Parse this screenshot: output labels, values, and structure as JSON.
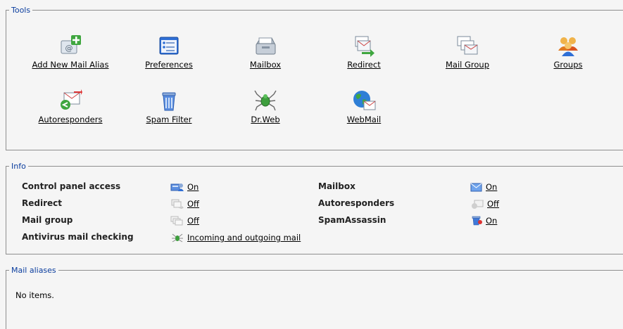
{
  "sections": {
    "tools": "Tools",
    "info": "Info",
    "mail_aliases": "Mail aliases"
  },
  "tools": [
    {
      "label": "Add New Mail Alias",
      "icon": "add-mail-alias-icon"
    },
    {
      "label": "Preferences",
      "icon": "preferences-icon"
    },
    {
      "label": "Mailbox",
      "icon": "mailbox-icon"
    },
    {
      "label": "Redirect",
      "icon": "redirect-icon"
    },
    {
      "label": "Mail Group",
      "icon": "mail-group-icon"
    },
    {
      "label": "Groups",
      "icon": "groups-icon"
    },
    {
      "label": "Autoresponders",
      "icon": "autoresponders-icon"
    },
    {
      "label": "Spam Filter",
      "icon": "spam-filter-icon"
    },
    {
      "label": "Dr.Web",
      "icon": "drweb-icon"
    },
    {
      "label": "WebMail",
      "icon": "webmail-icon"
    }
  ],
  "info": {
    "control_panel_access": {
      "label": "Control panel access",
      "value": "On"
    },
    "mailbox": {
      "label": "Mailbox",
      "value": "On"
    },
    "redirect": {
      "label": "Redirect",
      "value": "Off"
    },
    "autoresponders": {
      "label": "Autoresponders",
      "value": "Off"
    },
    "mail_group": {
      "label": "Mail group",
      "value": "Off"
    },
    "spamassassin": {
      "label": "SpamAssassin",
      "value": "On"
    },
    "antivirus": {
      "label": "Antivirus mail checking",
      "value": "Incoming and outgoing mail"
    }
  },
  "mail_aliases": {
    "empty_text": "No items."
  }
}
